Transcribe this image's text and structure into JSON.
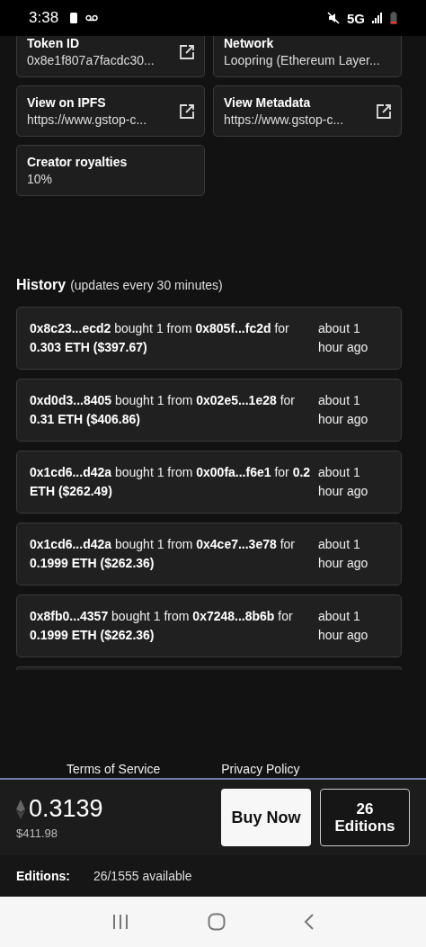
{
  "status_bar": {
    "time": "3:38",
    "network": "5G"
  },
  "details": [
    {
      "label": "Token ID",
      "value": "0x8e1f807a7facdc30...",
      "link": true
    },
    {
      "label": "Network",
      "value": "Loopring (Ethereum Layer...",
      "link": false
    },
    {
      "label": "View on IPFS",
      "value": "https://www.gstop-c...",
      "link": true
    },
    {
      "label": "View Metadata",
      "value": "https://www.gstop-c...",
      "link": true
    },
    {
      "label": "Creator royalties",
      "value": "10%",
      "link": false
    }
  ],
  "history": {
    "title": "History",
    "note": "(updates every 30 minutes)",
    "items": [
      {
        "text": "**0x8c23...ecd2** bought 1 from **0x805f...fc2d** for **0.303 ETH ($397.67)**",
        "time": "about 1 hour ago"
      },
      {
        "text": "**0xd0d3...8405** bought 1 from **0x02e5...1e28** for **0.31 ETH ($406.86)**",
        "time": "about 1 hour ago"
      },
      {
        "text": "**0x1cd6...d42a** bought 1 from **0x00fa...f6e1** for **0.2 ETH ($262.49)**",
        "time": "about 1 hour ago"
      },
      {
        "text": "**0x1cd6...d42a** bought 1 from **0x4ce7...3e78** for **0.1999 ETH ($262.36)**",
        "time": "about 1 hour ago"
      },
      {
        "text": "**0x8fb0...4357** bought 1 from **0x7248...8b6b** for **0.1999 ETH ($262.36)**",
        "time": "about 1 hour ago"
      }
    ]
  },
  "footer_links": [
    "Terms of Service",
    "Privacy Policy"
  ],
  "purchase": {
    "price": "0.3139",
    "usd": "$411.98",
    "buy_button": "Buy Now",
    "editions_button": "26 Editions"
  },
  "editions": {
    "label": "Editions:",
    "value": "26/1555 available"
  }
}
